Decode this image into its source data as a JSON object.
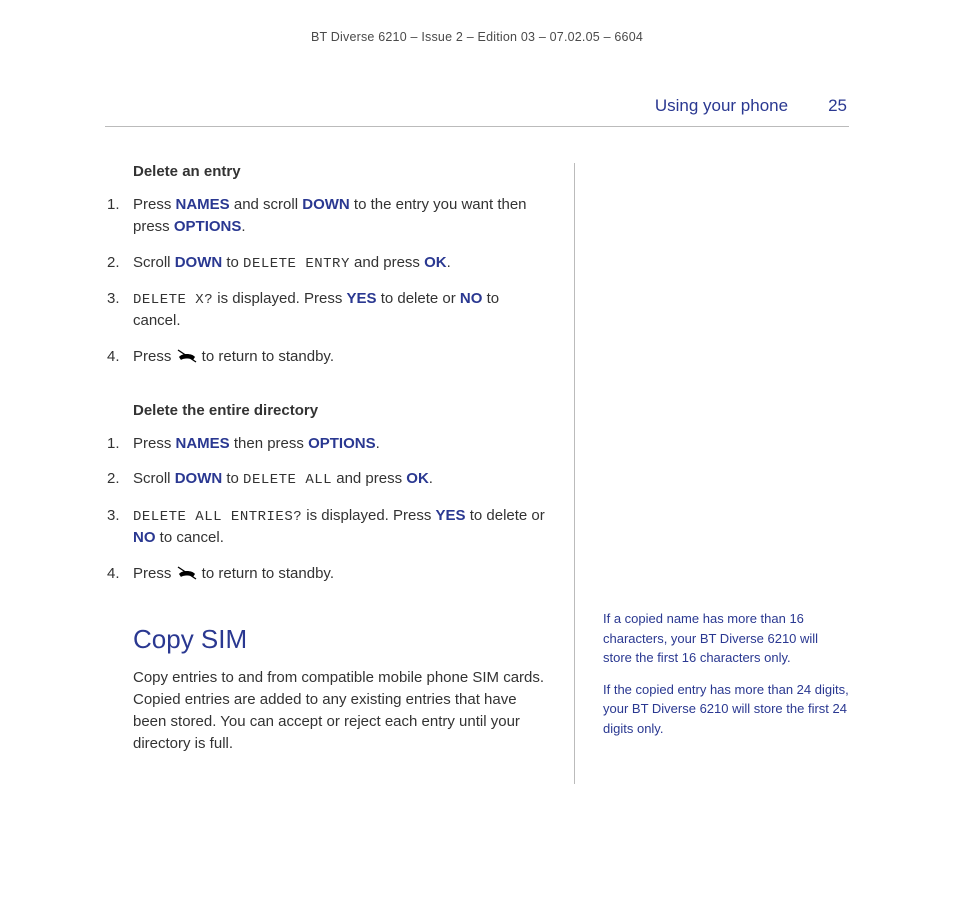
{
  "header": "BT Diverse 6210 – Issue 2 – Edition 03 – 07.02.05 – 6604",
  "section": {
    "title": "Using your phone",
    "page": "25"
  },
  "delete_entry": {
    "heading": "Delete an entry",
    "s1a": "Press ",
    "s1_names": "NAMES",
    "s1b": " and scroll ",
    "s1_down": "DOWN",
    "s1c": " to the entry you want then press ",
    "s1_options": "OPTIONS",
    "s1d": ".",
    "s2a": "Scroll ",
    "s2_down": "DOWN",
    "s2b": " to ",
    "s2_lcd": "DELETE ENTRY",
    "s2c": " and press ",
    "s2_ok": "OK",
    "s2d": ".",
    "s3_lcd": "DELETE X?",
    "s3a": " is displayed. Press ",
    "s3_yes": "YES",
    "s3b": " to delete or ",
    "s3_no": "NO",
    "s3c": " to cancel.",
    "s4a": "Press ",
    "s4b": " to return to standby."
  },
  "delete_dir": {
    "heading": "Delete the entire directory",
    "s1a": "Press ",
    "s1_names": "NAMES",
    "s1b": " then press ",
    "s1_options": "OPTIONS",
    "s1c": ".",
    "s2a": "Scroll ",
    "s2_down": "DOWN",
    "s2b": " to ",
    "s2_lcd": "DELETE ALL",
    "s2c": " and press ",
    "s2_ok": "OK",
    "s2d": ".",
    "s3_lcd": "DELETE ALL ENTRIES?",
    "s3a": " is displayed. Press ",
    "s3_yes": "YES",
    "s3b": " to delete or ",
    "s3_no": "NO",
    "s3c": " to cancel.",
    "s4a": "Press ",
    "s4b": " to return to standby."
  },
  "copy_sim": {
    "heading": "Copy SIM",
    "body": "Copy entries to and from compatible mobile phone SIM cards. Copied entries are added to any existing entries that have been stored. You can accept or reject each entry until your directory is full."
  },
  "sidenotes": {
    "n1": "If a copied name has more than 16 characters, your BT Diverse 6210 will store the first 16 characters only.",
    "n2": "If the copied entry has more than 24 digits, your BT Diverse 6210 will store the first 24 digits only."
  }
}
